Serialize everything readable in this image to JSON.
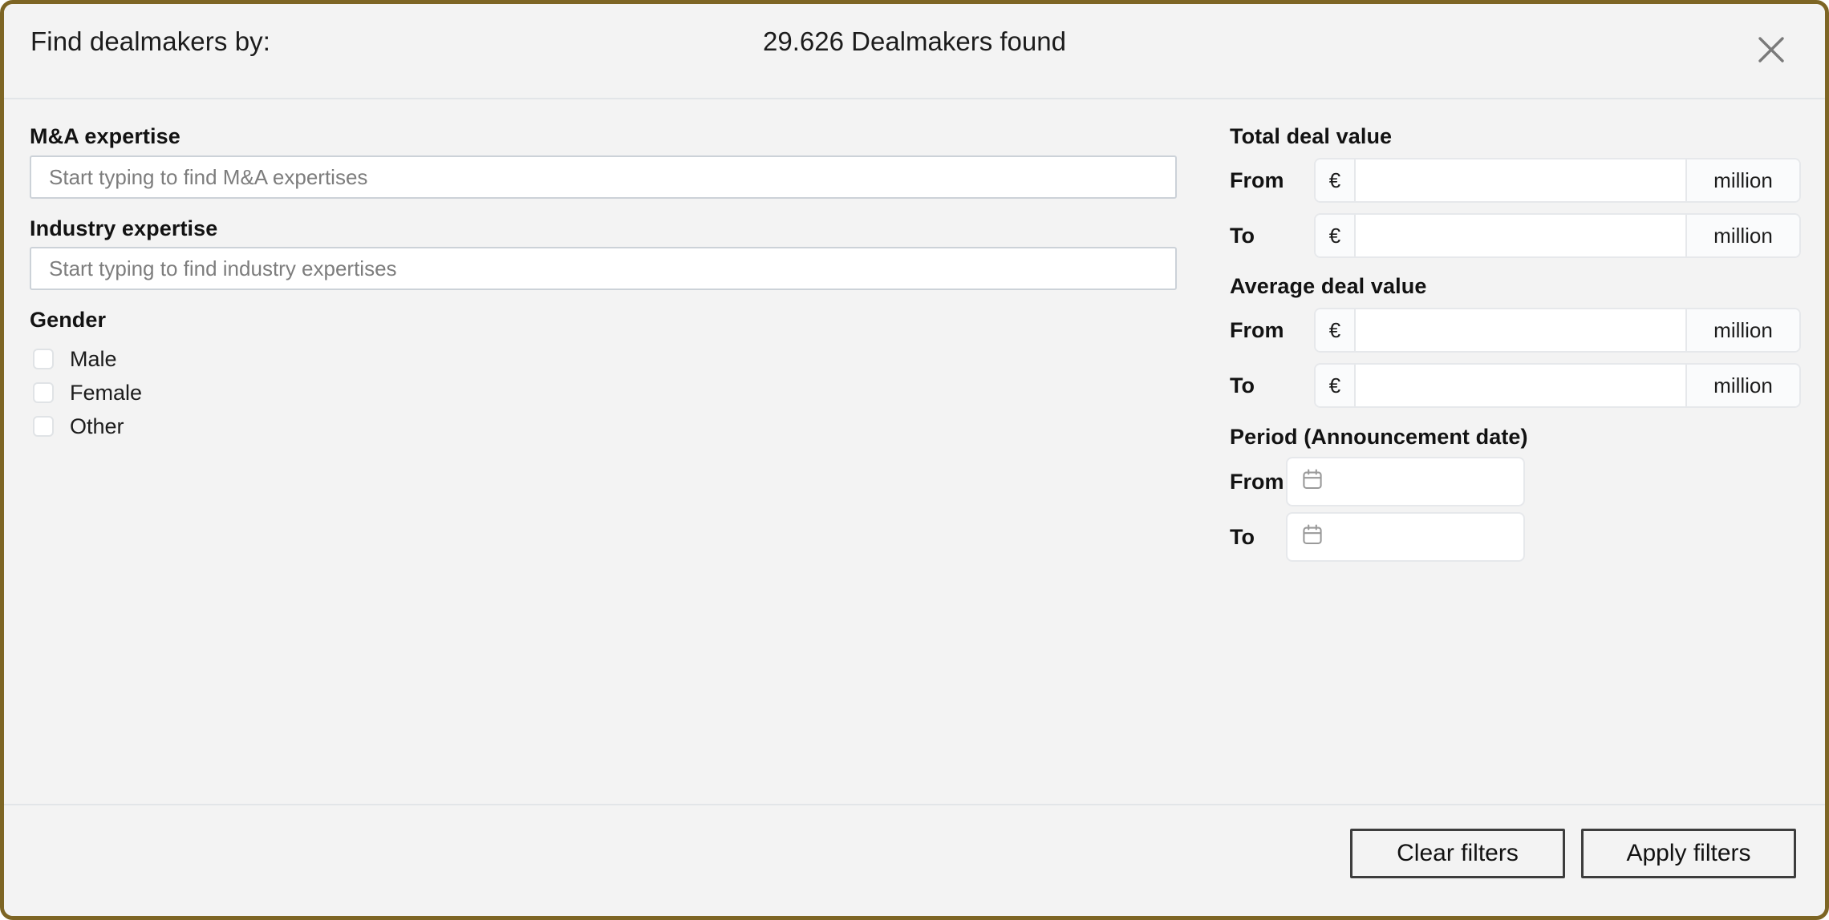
{
  "header": {
    "title": "Find dealmakers by:",
    "result_count_text": "29.626 Dealmakers found",
    "close_icon": "close-icon"
  },
  "left_column": {
    "ma_expertise": {
      "label": "M&A expertise",
      "placeholder": "Start typing to find M&A expertises",
      "value": ""
    },
    "industry_expertise": {
      "label": "Industry expertise",
      "placeholder": "Start typing to find industry expertises",
      "value": ""
    },
    "gender": {
      "label": "Gender",
      "options": [
        {
          "label": "Male",
          "checked": false
        },
        {
          "label": "Female",
          "checked": false
        },
        {
          "label": "Other",
          "checked": false
        }
      ]
    }
  },
  "right_column": {
    "total_deal_value": {
      "label": "Total deal value",
      "from_label": "From",
      "to_label": "To",
      "currency_symbol": "€",
      "unit_label": "million",
      "from_value": "",
      "to_value": ""
    },
    "average_deal_value": {
      "label": "Average deal value",
      "from_label": "From",
      "to_label": "To",
      "currency_symbol": "€",
      "unit_label": "million",
      "from_value": "",
      "to_value": ""
    },
    "period": {
      "label": "Period (Announcement date)",
      "from_label": "From",
      "to_label": "To",
      "from_value": "",
      "to_value": "",
      "icon": "calendar-icon"
    }
  },
  "footer": {
    "clear_label": "Clear filters",
    "apply_label": "Apply filters"
  },
  "colors": {
    "dialog_border": "#7d6524",
    "background": "#f3f3f3",
    "divider": "#e2e5e8",
    "input_border": "#ccd2d8",
    "group_border": "#e6e8eb",
    "addon_background": "#fafbfc",
    "placeholder_text": "#7d7d7d",
    "text": "#1c1c1c",
    "button_border": "#3d3d3d",
    "icon_gray": "#7a7a7a"
  }
}
